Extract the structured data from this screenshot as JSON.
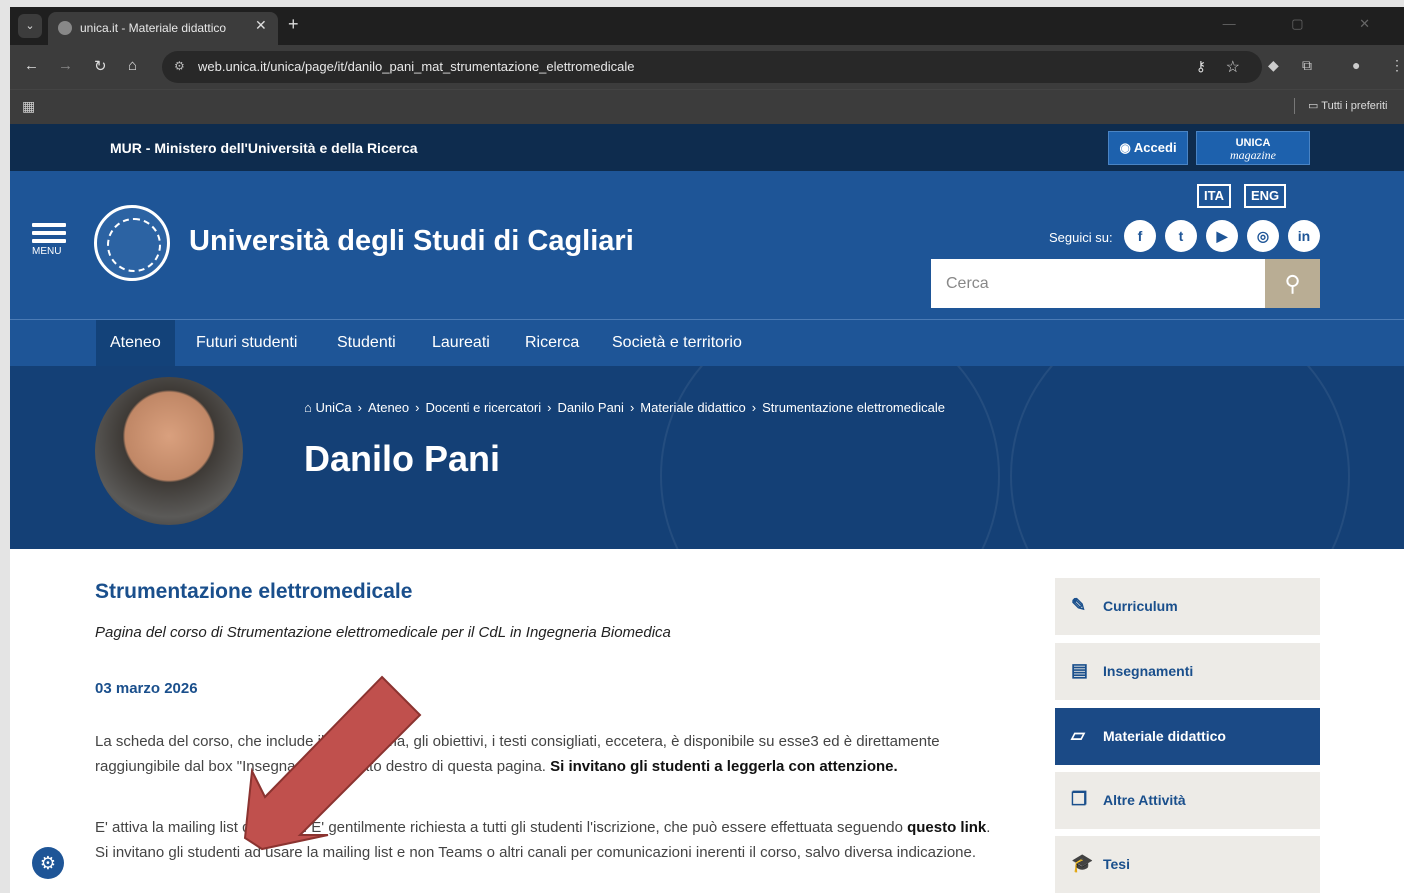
{
  "browser": {
    "tab_title": "unica.it - Materiale didattico",
    "tab_close": "✕",
    "new_tab": "+",
    "url": "web.unica.it/unica/page/it/danilo_pani_mat_strumentazione_elettromedicale",
    "bookmarks_label": "Tutti i preferiti",
    "window_controls": "— ▢ ✕"
  },
  "topbar": {
    "ministry": "MUR - Ministero dell'Università e della Ricerca",
    "login_label": "Accedi",
    "magazine_top": "UNICA",
    "magazine_bottom": "magazine"
  },
  "header": {
    "menu_label": "MENU",
    "university_name": "Università degli Studi di Cagliari",
    "lang_ita": "ITA",
    "lang_eng": "ENG",
    "follow_label": "Seguici su:",
    "social": [
      "facebook-icon",
      "twitter-icon",
      "youtube-icon",
      "instagram-icon",
      "linkedin-icon"
    ],
    "search_placeholder": "Cerca"
  },
  "nav": {
    "items": [
      "Ateneo",
      "Futuri studenti",
      "Studenti",
      "Laureati",
      "Ricerca",
      "Società e territorio"
    ],
    "active": "Ateneo"
  },
  "hero": {
    "breadcrumb": [
      "UniCa",
      "Ateneo",
      "Docenti e ricercatori",
      "Danilo Pani",
      "Materiale didattico",
      "Strumentazione elettromedicale"
    ],
    "person_name": "Danilo Pani"
  },
  "content": {
    "title": "Strumentazione elettromedicale",
    "subtitle": "Pagina del corso di Strumentazione elettromedicale per il CdL in Ingegneria Biomedica",
    "date": "03 marzo 2026",
    "p1_part1": "La scheda del corso, che include il programma, gli obiettivi, i testi consigliati, eccetera, è disponibile su esse3 ed è direttamente raggiungibile dal box \"Insegnamenti\" al lato destro di questa pagina. ",
    "p1_bold": "Si invitano gli studenti a leggerla con attenzione.",
    "p2_part1": "E' attiva la mailing list del corso. E' gentilmente richiesta a tutti gli studenti l'iscrizione, che può essere effettuata seguendo ",
    "p2_link": "questo link",
    "p2_part2": ". Si invitano gli studenti ad usare la mailing list e non Teams o altri canali per comunicazioni inerenti il corso, salvo diversa indicazione."
  },
  "sidebar": {
    "items": [
      "Curriculum",
      "Insegnamenti",
      "Materiale didattico",
      "Altre Attività",
      "Tesi"
    ],
    "active": "Materiale didattico"
  },
  "colors": {
    "header_blue": "#1e5597",
    "dark_navy": "#0e2c4e",
    "accent_tan": "#b9ad94",
    "arrow_red": "#c0504d"
  }
}
